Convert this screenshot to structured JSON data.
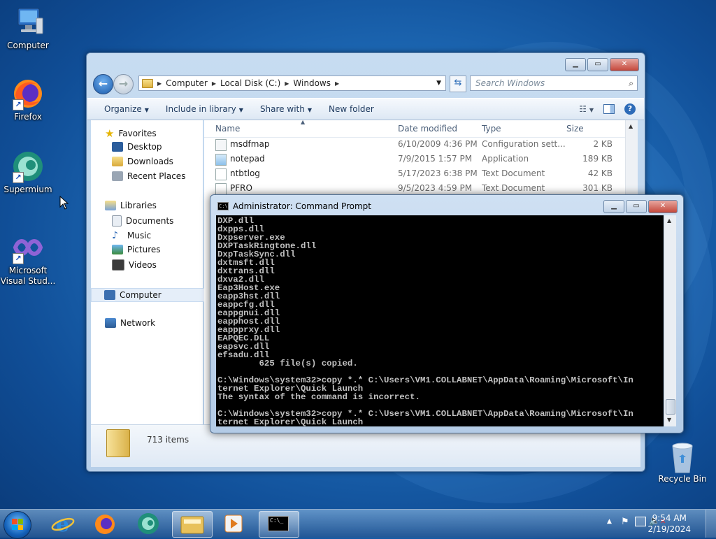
{
  "desktop": {
    "icons": [
      {
        "label": "Computer"
      },
      {
        "label": "Firefox"
      },
      {
        "label": "Supermium"
      },
      {
        "label": "Microsoft Visual Stud..."
      },
      {
        "label": "Recycle Bin"
      }
    ]
  },
  "explorer": {
    "breadcrumb": [
      "Computer",
      "Local Disk (C:)",
      "Windows"
    ],
    "search_placeholder": "Search Windows",
    "toolbar": {
      "organize": "Organize",
      "include_in_library": "Include in library",
      "share_with": "Share with",
      "new_folder": "New folder"
    },
    "nav": {
      "favorites": "Favorites",
      "desktop": "Desktop",
      "downloads": "Downloads",
      "recent_places": "Recent Places",
      "libraries": "Libraries",
      "documents": "Documents",
      "music": "Music",
      "pictures": "Pictures",
      "videos": "Videos",
      "computer": "Computer",
      "network": "Network"
    },
    "columns": {
      "name": "Name",
      "date": "Date modified",
      "type": "Type",
      "size": "Size"
    },
    "files": [
      {
        "name": "msdfmap",
        "date": "6/10/2009 4:36 PM",
        "type": "Configuration sett...",
        "size": "2 KB"
      },
      {
        "name": "notepad",
        "date": "7/9/2015 1:57 PM",
        "type": "Application",
        "size": "189 KB"
      },
      {
        "name": "ntbtlog",
        "date": "5/17/2023 6:38 PM",
        "type": "Text Document",
        "size": "42 KB"
      },
      {
        "name": "PFRO",
        "date": "9/5/2023 4:59 PM",
        "type": "Text Document",
        "size": "301 KB"
      }
    ],
    "status": "713 items"
  },
  "cmd": {
    "title": "Administrator: Command Prompt",
    "icon_text": "C:\\",
    "lines": [
      "DXP.dll",
      "dxpps.dll",
      "Dxpserver.exe",
      "DXPTaskRingtone.dll",
      "DxpTaskSync.dll",
      "dxtmsft.dll",
      "dxtrans.dll",
      "dxva2.dll",
      "Eap3Host.exe",
      "eapp3hst.dll",
      "eappcfg.dll",
      "eappgnui.dll",
      "eapphost.dll",
      "eappprxy.dll",
      "EAPQEC.DLL",
      "eapsvc.dll",
      "efsadu.dll",
      "        625 file(s) copied.",
      "",
      "C:\\Windows\\system32>copy *.* C:\\Users\\VM1.COLLABNET\\AppData\\Roaming\\Microsoft\\In",
      "ternet Explorer\\Quick Launch",
      "The syntax of the command is incorrect.",
      "",
      "C:\\Windows\\system32>copy *.* C:\\Users\\VM1.COLLABNET\\AppData\\Roaming\\Microsoft\\In",
      "ternet Explorer\\Quick Launch"
    ]
  },
  "taskbar": {
    "time": "9:54 AM",
    "date": "2/19/2024",
    "cmd_icon_text": "C:\\_"
  }
}
